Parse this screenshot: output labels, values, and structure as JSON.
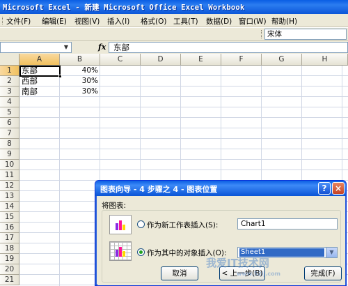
{
  "window": {
    "title": "Microsoft Excel - 新建 Microsoft Office Excel Workbook"
  },
  "menu": {
    "items": [
      "文件(F)",
      "编辑(E)",
      "视图(V)",
      "插入(I)",
      "格式(O)",
      "工具(T)",
      "数据(D)",
      "窗口(W)",
      "帮助(H)"
    ]
  },
  "toolbar": {
    "font_name": "宋体"
  },
  "formula_bar": {
    "name_box": "",
    "fx_label": "fx",
    "content": "东部"
  },
  "sheet": {
    "columns": [
      "A",
      "B",
      "C",
      "D",
      "E",
      "F",
      "G",
      "H"
    ],
    "selected_column": "A",
    "rows": [
      "1",
      "2",
      "3",
      "4",
      "5",
      "6",
      "7",
      "8",
      "9",
      "10",
      "11",
      "12",
      "13",
      "14",
      "15",
      "16",
      "17",
      "18",
      "19",
      "20",
      "21"
    ],
    "selected_row": "1",
    "data": [
      {
        "a": "东部",
        "b": "40%"
      },
      {
        "a": "西部",
        "b": "30%"
      },
      {
        "a": "南部",
        "b": "30%"
      }
    ]
  },
  "dialog": {
    "title": "图表向导 - 4 步骤之 4 - 图表位置",
    "help_button": "?",
    "close_button": "×",
    "place_label": "将图表:",
    "option_new_sheet": {
      "label": "作为新工作表插入(S):",
      "value": "Chart1",
      "selected": false
    },
    "option_object": {
      "label": "作为其中的对象插入(O):",
      "value": "Sheet1",
      "selected": true
    },
    "buttons": {
      "cancel": "取消",
      "back": "< 上一步(B)",
      "finish": "完成(F)"
    }
  },
  "watermark": {
    "line1": "我爱IT技术网",
    "line2": "www.52ij.com"
  },
  "colors": {
    "title_bar": "#0a5ee4",
    "selected_header": "#f1c15f",
    "grid_line": "#d0d7e5",
    "dialog_bg": "#ece9d8"
  }
}
